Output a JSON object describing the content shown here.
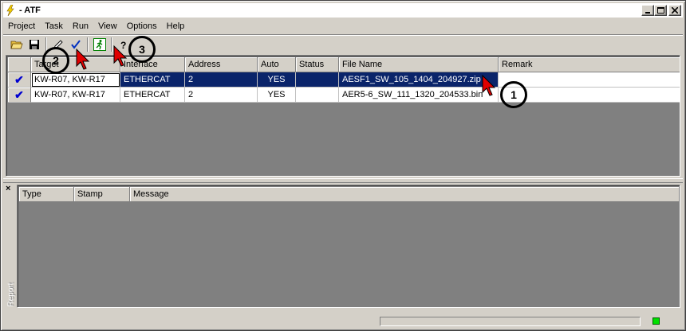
{
  "window": {
    "title": "- ATF"
  },
  "menu": [
    "Project",
    "Task",
    "Run",
    "View",
    "Options",
    "Help"
  ],
  "toolbar": {
    "buttons": [
      {
        "icon": "open-folder-icon"
      },
      {
        "icon": "save-disk-icon"
      },
      {
        "icon": "edit-pencil-icon"
      },
      {
        "icon": "checkmark-icon"
      },
      {
        "icon": "run-man-icon"
      },
      {
        "icon": "help-question-icon"
      }
    ]
  },
  "grid": {
    "columns": [
      "",
      "Target",
      "Interface",
      "Address",
      "Auto",
      "Status",
      "File Name",
      "Remark"
    ],
    "rows": [
      {
        "checked": "✔",
        "target": "KW-R07, KW-R17",
        "interface": "ETHERCAT",
        "address": "2",
        "auto": "YES",
        "status": "",
        "file_name": "AESF1_SW_105_1404_204927.zip",
        "remark": "",
        "selected": true
      },
      {
        "checked": "✔",
        "target": "KW-R07, KW-R17",
        "interface": "ETHERCAT",
        "address": "2",
        "auto": "YES",
        "status": "",
        "file_name": "AER5-6_SW_111_1320_204533.bin",
        "remark": "",
        "selected": false
      }
    ]
  },
  "report": {
    "side_label": "Report",
    "close_glyph": "×",
    "columns": [
      "Type",
      "Stamp",
      "Message"
    ]
  },
  "annotations": [
    "1",
    "2",
    "3"
  ],
  "colors": {
    "selection": "#0a246a",
    "led": "#00e000",
    "cursor": "#e00000"
  }
}
